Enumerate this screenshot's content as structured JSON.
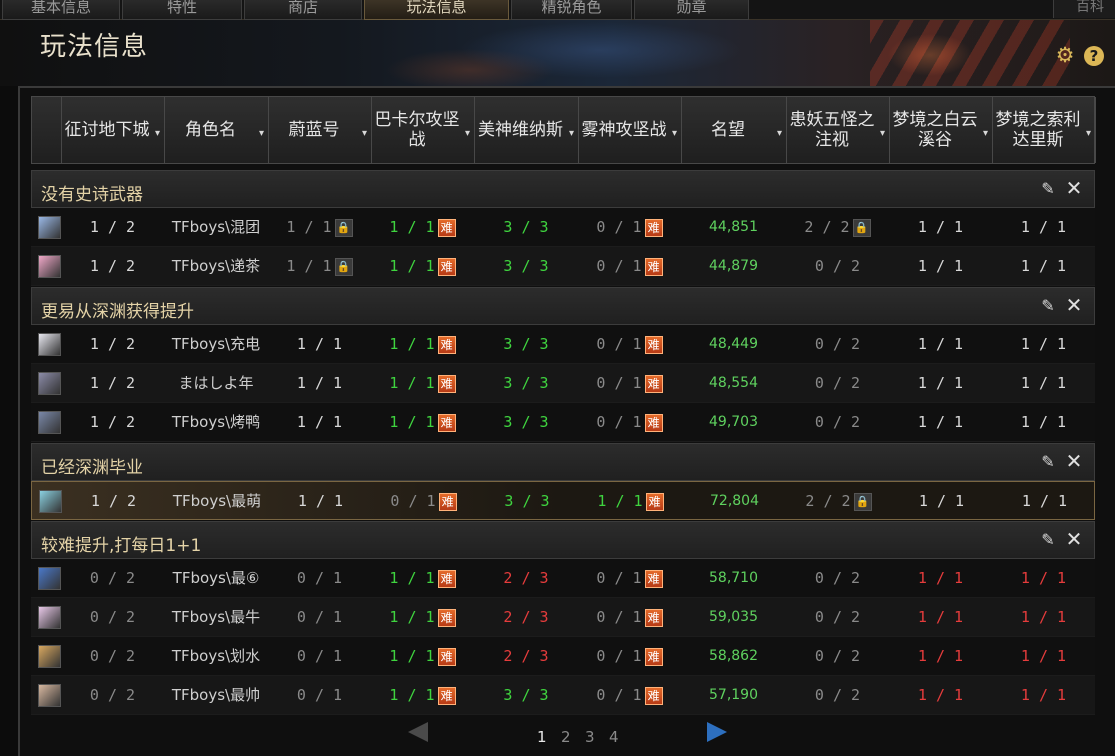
{
  "tabs": [
    {
      "label": "基本信息",
      "active": false
    },
    {
      "label": "特性",
      "active": false
    },
    {
      "label": "商店",
      "active": false
    },
    {
      "label": "玩法信息",
      "active": true
    },
    {
      "label": "精锐角色",
      "active": false
    },
    {
      "label": "勋章",
      "active": false
    }
  ],
  "tab_right_label": "百科",
  "page_title": "玩法信息",
  "icons": {
    "settings": "gear-icon",
    "help": "question-circle-icon",
    "edit": "pencil-icon",
    "close": "close-icon",
    "lock": "lock-icon",
    "prev": "triangle-left-icon",
    "next": "triangle-right-icon"
  },
  "columns": [
    {
      "label": "",
      "sortable": false
    },
    {
      "label": "征讨地下城",
      "sortable": true
    },
    {
      "label": "角色名",
      "sortable": true
    },
    {
      "label": "蔚蓝号",
      "sortable": true
    },
    {
      "label": "巴卡尔攻坚战",
      "sortable": true
    },
    {
      "label": "美神维纳斯",
      "sortable": true
    },
    {
      "label": "雾神攻坚战",
      "sortable": true
    },
    {
      "label": "名望",
      "sortable": true
    },
    {
      "label": "患妖五怪之注视",
      "sortable": true
    },
    {
      "label": "梦境之白云溪谷",
      "sortable": true
    },
    {
      "label": "梦境之索利达里斯",
      "sortable": true
    }
  ],
  "hard_badge_text": "难",
  "colors": {
    "green": "#3fd43f",
    "red": "#e53c3c",
    "gray": "#8a8a8a",
    "gold": "#e4d3a7",
    "hard_badge": "#d0501f"
  },
  "groups": [
    {
      "title": "没有史诗武器",
      "rows": [
        {
          "avatar": "#9ab8e6",
          "dungeon": "1 / 2",
          "name": "TFboys\\混团",
          "weilan": "1 / 1",
          "weilan_lock": true,
          "bakal": "1 / 1",
          "bakal_hard": true,
          "venus": "3 / 3",
          "venus_color": "green",
          "wushen": "0 / 1",
          "wushen_hard": true,
          "fame": "44,851",
          "wuyao": "2 / 2",
          "wuyao_lock": true,
          "baiyun": "1 / 1",
          "baiyun_color": "white",
          "solidaris": "1 / 1",
          "solidaris_color": "white"
        },
        {
          "avatar": "#f0a8c8",
          "dungeon": "1 / 2",
          "name": "TFboys\\递茶",
          "weilan": "1 / 1",
          "weilan_lock": true,
          "bakal": "1 / 1",
          "bakal_hard": true,
          "venus": "3 / 3",
          "venus_color": "green",
          "wushen": "0 / 1",
          "wushen_hard": true,
          "fame": "44,879",
          "wuyao": "0 / 2",
          "wuyao_lock": false,
          "baiyun": "1 / 1",
          "baiyun_color": "white",
          "solidaris": "1 / 1",
          "solidaris_color": "white"
        }
      ]
    },
    {
      "title": "更易从深渊获得提升",
      "rows": [
        {
          "avatar": "#e8e8f0",
          "dungeon": "1 / 2",
          "name": "TFboys\\充电",
          "weilan": "1 / 1",
          "weilan_lock": false,
          "bakal": "1 / 1",
          "bakal_hard": true,
          "venus": "3 / 3",
          "venus_color": "green",
          "wushen": "0 / 1",
          "wushen_hard": true,
          "fame": "48,449",
          "wuyao": "0 / 2",
          "wuyao_lock": false,
          "baiyun": "1 / 1",
          "baiyun_color": "white",
          "solidaris": "1 / 1",
          "solidaris_color": "white"
        },
        {
          "avatar": "#8c8ca8",
          "dungeon": "1 / 2",
          "name": "まはしよ年",
          "weilan": "1 / 1",
          "weilan_lock": false,
          "bakal": "1 / 1",
          "bakal_hard": true,
          "venus": "3 / 3",
          "venus_color": "green",
          "wushen": "0 / 1",
          "wushen_hard": true,
          "fame": "48,554",
          "wuyao": "0 / 2",
          "wuyao_lock": false,
          "baiyun": "1 / 1",
          "baiyun_color": "white",
          "solidaris": "1 / 1",
          "solidaris_color": "white"
        },
        {
          "avatar": "#7a88a8",
          "dungeon": "1 / 2",
          "name": "TFboys\\烤鸭",
          "weilan": "1 / 1",
          "weilan_lock": false,
          "bakal": "1 / 1",
          "bakal_hard": true,
          "venus": "3 / 3",
          "venus_color": "green",
          "wushen": "0 / 1",
          "wushen_hard": true,
          "fame": "49,703",
          "wuyao": "0 / 2",
          "wuyao_lock": false,
          "baiyun": "1 / 1",
          "baiyun_color": "white",
          "solidaris": "1 / 1",
          "solidaris_color": "white"
        }
      ]
    },
    {
      "title": "已经深渊毕业",
      "rows": [
        {
          "avatar": "#8ad0e0",
          "dungeon": "1 / 2",
          "name": "TFboys\\最萌",
          "weilan": "1 / 1",
          "weilan_lock": false,
          "bakal": "0 / 1",
          "bakal_hard": true,
          "bakal_color": "gray",
          "venus": "3 / 3",
          "venus_color": "green",
          "wushen": "1 / 1",
          "wushen_hard": true,
          "wushen_color": "green",
          "fame": "72,804",
          "wuyao": "2 / 2",
          "wuyao_lock": true,
          "baiyun": "1 / 1",
          "baiyun_color": "white",
          "solidaris": "1 / 1",
          "solidaris_color": "white",
          "selected": true
        }
      ]
    },
    {
      "title": "较难提升,打每日1+1",
      "rows": [
        {
          "avatar": "#4a78c8",
          "dungeon": "0 / 2",
          "name": "TFboys\\最⑥",
          "weilan": "0 / 1",
          "weilan_lock": false,
          "bakal": "1 / 1",
          "bakal_hard": true,
          "venus": "2 / 3",
          "venus_color": "red",
          "wushen": "0 / 1",
          "wushen_hard": true,
          "fame": "58,710",
          "wuyao": "0 / 2",
          "wuyao_lock": false,
          "baiyun": "1 / 1",
          "baiyun_color": "red",
          "solidaris": "1 / 1",
          "solidaris_color": "red"
        },
        {
          "avatar": "#e8c8e8",
          "dungeon": "0 / 2",
          "name": "TFboys\\最牛",
          "weilan": "0 / 1",
          "weilan_lock": false,
          "bakal": "1 / 1",
          "bakal_hard": true,
          "venus": "2 / 3",
          "venus_color": "red",
          "wushen": "0 / 1",
          "wushen_hard": true,
          "fame": "59,035",
          "wuyao": "0 / 2",
          "wuyao_lock": false,
          "baiyun": "1 / 1",
          "baiyun_color": "red",
          "solidaris": "1 / 1",
          "solidaris_color": "red"
        },
        {
          "avatar": "#d8a860",
          "dungeon": "0 / 2",
          "name": "TFboys\\划水",
          "weilan": "0 / 1",
          "weilan_lock": false,
          "bakal": "1 / 1",
          "bakal_hard": true,
          "venus": "2 / 3",
          "venus_color": "red",
          "wushen": "0 / 1",
          "wushen_hard": true,
          "fame": "58,862",
          "wuyao": "0 / 2",
          "wuyao_lock": false,
          "baiyun": "1 / 1",
          "baiyun_color": "red",
          "solidaris": "1 / 1",
          "solidaris_color": "red"
        },
        {
          "avatar": "#d8b8a0",
          "dungeon": "0 / 2",
          "name": "TFboys\\最帅",
          "weilan": "0 / 1",
          "weilan_lock": false,
          "bakal": "1 / 1",
          "bakal_hard": true,
          "venus": "3 / 3",
          "venus_color": "green",
          "wushen": "0 / 1",
          "wushen_hard": true,
          "fame": "57,190",
          "wuyao": "0 / 2",
          "wuyao_lock": false,
          "baiyun": "1 / 1",
          "baiyun_color": "red",
          "solidaris": "1 / 1",
          "solidaris_color": "red"
        }
      ]
    }
  ],
  "pagination": {
    "pages": [
      "1",
      "2",
      "3",
      "4"
    ],
    "current": "1"
  }
}
